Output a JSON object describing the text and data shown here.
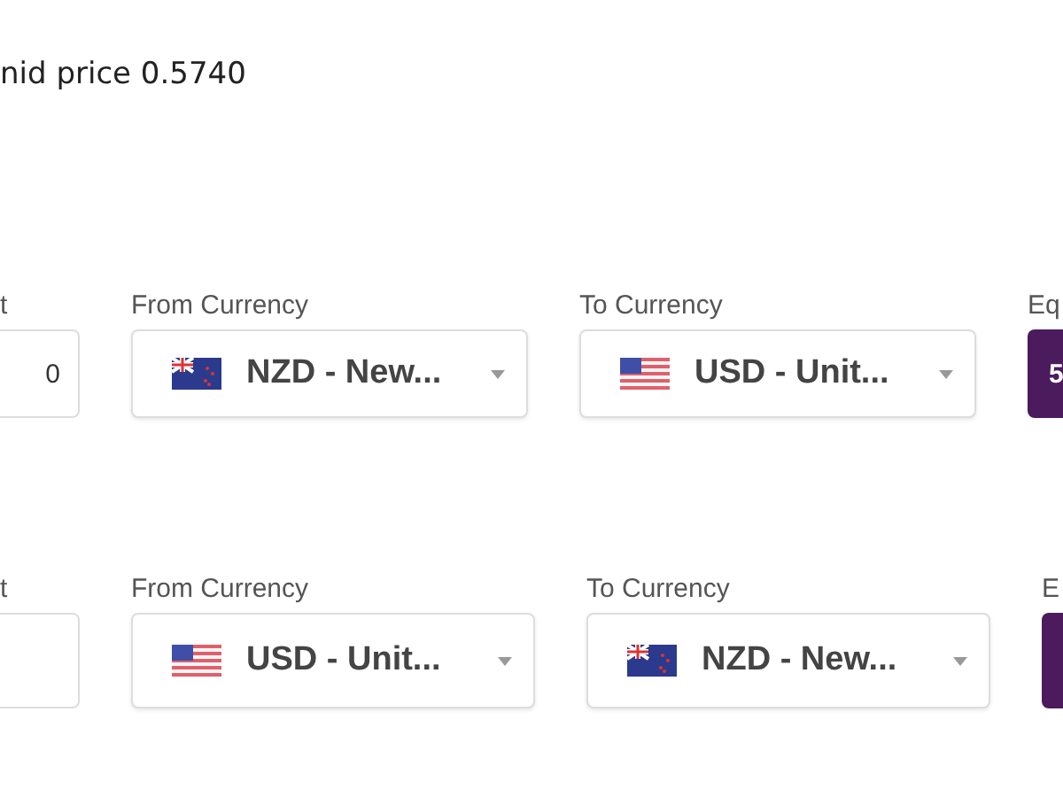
{
  "mid_price": "nid price 0.5740",
  "converters": [
    {
      "amount_label": "t",
      "amount": "0",
      "from_label": "From Currency",
      "from": {
        "kind": "nz",
        "text": "NZD - New..."
      },
      "to_label": "To Currency",
      "to": {
        "kind": "us",
        "text": "USD - Unit..."
      },
      "result_label": "Eq",
      "result": "5"
    },
    {
      "amount_label": "t",
      "from_label": "From Currency",
      "from": {
        "kind": "us",
        "text": "USD - Unit..."
      },
      "to_label": "To Currency",
      "to": {
        "kind": "nz",
        "text": "NZD - New..."
      },
      "result_label": "E"
    }
  ]
}
